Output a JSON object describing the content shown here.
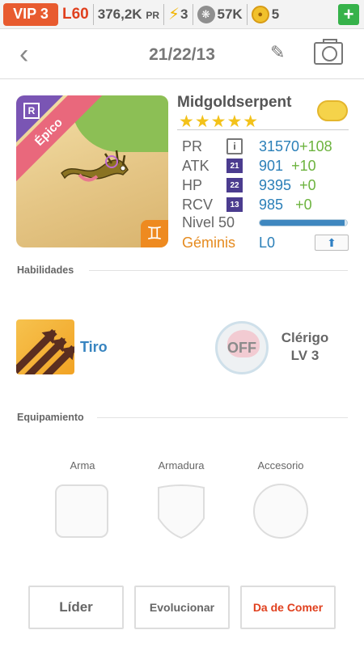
{
  "status_bar": {
    "vip": "VIP 3",
    "level": "L60",
    "power_value": "376,2K",
    "power_unit": "PR",
    "energy": "3",
    "paw_count": "57K",
    "coins": "5",
    "add_label": "+",
    "icons": {
      "energy": "lightning-bolt-icon",
      "paw": "paw-icon",
      "coin": "coin-icon"
    },
    "colors": {
      "vip_bg": "#e85b2f",
      "add_bg": "#36b24a"
    }
  },
  "header": {
    "back_glyph": "‹",
    "title": "21/22/13",
    "edit_glyph": "✎"
  },
  "monster": {
    "rarity": "Épico",
    "rarity_badge": "R",
    "name": "Midgoldserpent",
    "stars": "★★★★★",
    "star_count": 5,
    "zodiac_glyph": "♊",
    "stats": [
      {
        "label": "PR",
        "badge": "i",
        "value": "31570",
        "bonus": "+108"
      },
      {
        "label": "ATK",
        "badge": "21",
        "value": "901",
        "bonus": "+10"
      },
      {
        "label": "HP",
        "badge": "22",
        "value": "9395",
        "bonus": "+0"
      },
      {
        "label": "RCV",
        "badge": "13",
        "value": "985",
        "bonus": "+0"
      }
    ],
    "level_label": "Nivel 50",
    "xp_fraction": 0.97,
    "sign": "Géminis",
    "rank": "L0",
    "upgrade_glyph": "⬆"
  },
  "skills": {
    "section_title": "Habilidades",
    "active_name": "Tiro",
    "leader_state": "OFF",
    "leader_class": "Clérigo",
    "leader_level": "LV 3"
  },
  "equipment": {
    "section_title": "Equipamiento",
    "weapon": "Arma",
    "armor": "Armadura",
    "accessory": "Accesorio"
  },
  "actions": {
    "leader": "Líder",
    "evolve": "Evolucionar",
    "feed": "Da de Comer"
  }
}
